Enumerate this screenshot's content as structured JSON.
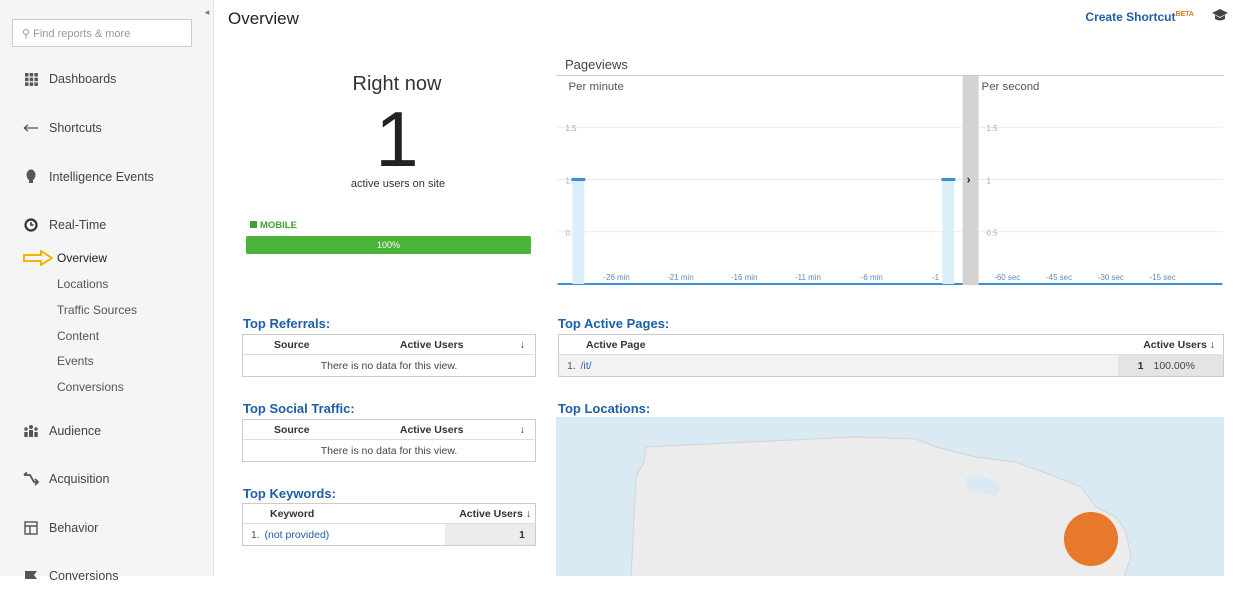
{
  "sidebar": {
    "search_placeholder": "Find reports & more",
    "items": [
      {
        "label": "Dashboards",
        "icon": "grid-icon"
      },
      {
        "label": "Shortcuts",
        "icon": "arrow-left-icon"
      },
      {
        "label": "Intelligence Events",
        "icon": "lightbulb-icon"
      },
      {
        "label": "Real-Time",
        "icon": "clock-icon"
      },
      {
        "label": "Audience",
        "icon": "people-icon"
      },
      {
        "label": "Acquisition",
        "icon": "acquisition-icon"
      },
      {
        "label": "Behavior",
        "icon": "behavior-icon"
      },
      {
        "label": "Conversions",
        "icon": "flag-icon"
      }
    ],
    "realtime_sub": [
      "Overview",
      "Locations",
      "Traffic Sources",
      "Content",
      "Events",
      "Conversions"
    ]
  },
  "header": {
    "title": "Overview",
    "shortcut_label": "Create Shortcut",
    "beta": "BETA"
  },
  "rightnow": {
    "label": "Right now",
    "count": "1",
    "sublabel": "active users on site",
    "device_label": "MOBILE",
    "device_percent": "100%",
    "device_fraction": 1.0
  },
  "pageviews": {
    "title": "Pageviews",
    "per_minute": "Per minute",
    "per_second": "Per second",
    "expand_glyph": "›"
  },
  "colors": {
    "accent": "#1d5fa8",
    "mobile": "#4cb33a",
    "map_dot": "#e8792c",
    "chart_line": "#3a8fd6"
  },
  "chart_data": [
    {
      "type": "bar",
      "title": "Per minute",
      "ylim": [
        0,
        1.8
      ],
      "yticks": [
        "1.5",
        "1.0",
        "0.5"
      ],
      "xticks": [
        "-26 min",
        "-21 min",
        "-16 min",
        "-11 min",
        "-6 min",
        "-1"
      ],
      "series": [
        {
          "values": [
            {
              "x": -29,
              "y": 1
            },
            {
              "x": 0,
              "y": 1
            }
          ]
        }
      ]
    },
    {
      "type": "bar",
      "title": "Per second",
      "ylim": [
        0,
        1.8
      ],
      "yticks": [
        "1.5",
        "1",
        "0.5"
      ],
      "xticks": [
        "-60 sec",
        "-45 sec",
        "-30 sec",
        "-15 sec"
      ],
      "series": [
        {
          "values": []
        }
      ]
    }
  ],
  "tables": {
    "referrals": {
      "title": "Top Referrals:",
      "col1": "Source",
      "col2": "Active Users",
      "empty": "There is no data for this view."
    },
    "social": {
      "title": "Top Social Traffic:",
      "col1": "Source",
      "col2": "Active Users",
      "empty": "There is no data for this view."
    },
    "keywords": {
      "title": "Top Keywords:",
      "col1": "Keyword",
      "col2": "Active Users",
      "rows": [
        {
          "idx": "1.",
          "name": "(not provided)",
          "value": "1"
        }
      ]
    },
    "pages": {
      "title": "Top Active Pages:",
      "col1": "Active Page",
      "col2": "Active Users",
      "rows": [
        {
          "idx": "1.",
          "name": "/it/",
          "value": "1",
          "pct": "100.00%"
        }
      ]
    },
    "locations": {
      "title": "Top Locations:"
    }
  }
}
